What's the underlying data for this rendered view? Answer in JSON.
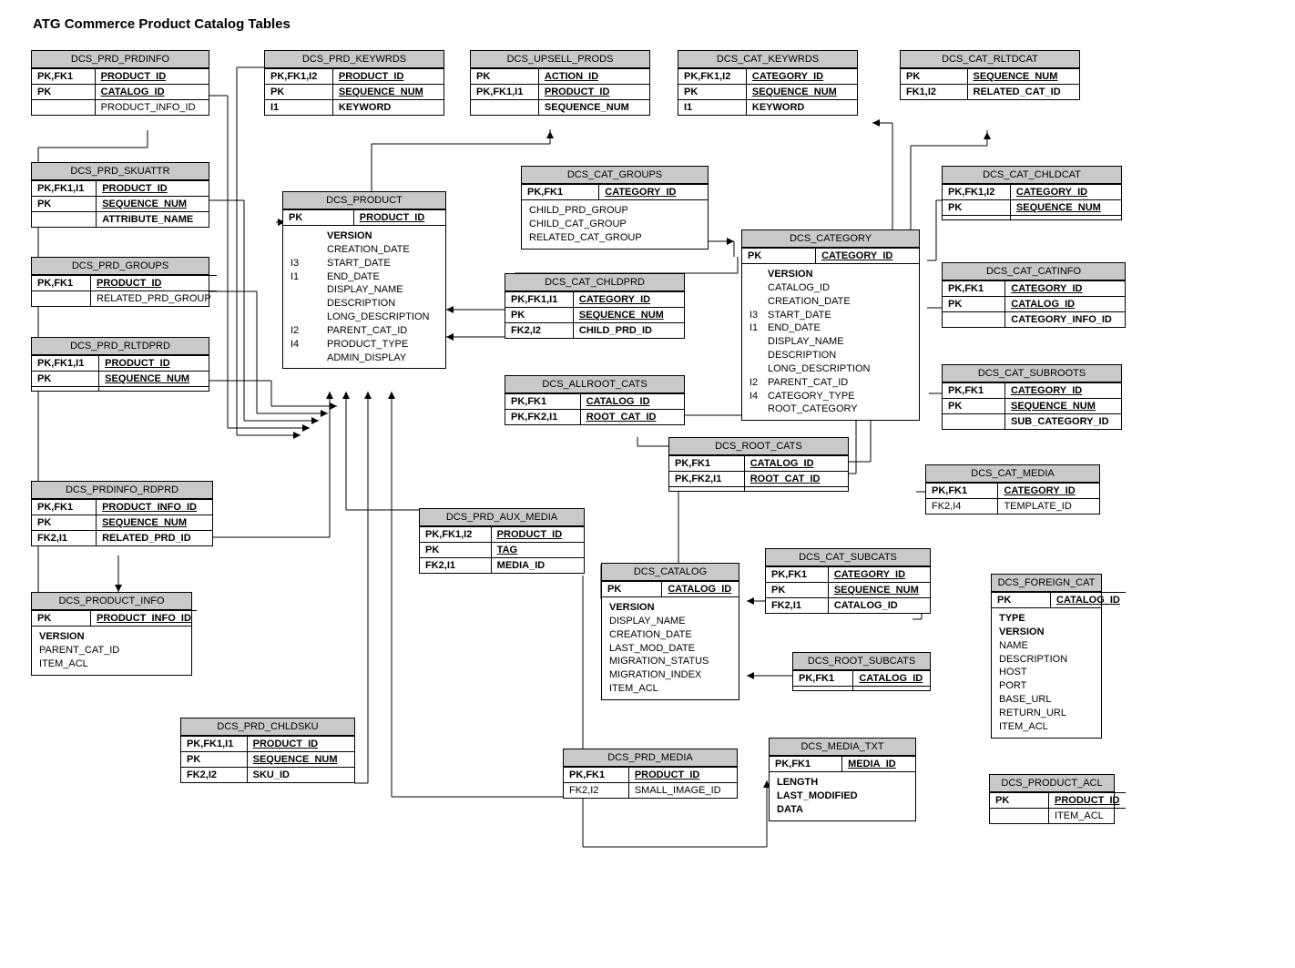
{
  "title": "ATG Commerce Product Catalog Tables",
  "tables": {
    "prd_prdinfo": {
      "name": "DCS_PRD_PRDINFO",
      "rows": [
        {
          "key": "PK,FK1",
          "val": "PRODUCT_ID",
          "pk": true
        },
        {
          "key": "PK",
          "val": "CATALOG_ID",
          "pk": true
        },
        {
          "key": "",
          "val": "PRODUCT_INFO_ID",
          "plain": true
        }
      ]
    },
    "prd_keywrds": {
      "name": "DCS_PRD_KEYWRDS",
      "rows": [
        {
          "key": "PK,FK1,I2",
          "val": "PRODUCT_ID",
          "pk": true
        },
        {
          "key": "PK",
          "val": "SEQUENCE_NUM",
          "pk": true
        },
        {
          "key": "I1",
          "val": "KEYWORD",
          "bold": true
        }
      ]
    },
    "upsell_prods": {
      "name": "DCS_UPSELL_PRODS",
      "rows": [
        {
          "key": "PK",
          "val": "ACTION_ID",
          "pk": true
        },
        {
          "key": "PK,FK1,I1",
          "val": "PRODUCT_ID",
          "pk": true
        },
        {
          "key": "",
          "val": "SEQUENCE_NUM",
          "bold": true
        }
      ]
    },
    "cat_keywrds": {
      "name": "DCS_CAT_KEYWRDS",
      "rows": [
        {
          "key": "PK,FK1,I2",
          "val": "CATEGORY_ID",
          "pk": true
        },
        {
          "key": "PK",
          "val": "SEQUENCE_NUM",
          "pk": true
        },
        {
          "key": "I1",
          "val": "KEYWORD",
          "bold": true
        }
      ]
    },
    "cat_rltdcat": {
      "name": "DCS_CAT_RLTDCAT",
      "rows": [
        {
          "key": "PK",
          "val": "SEQUENCE_NUM",
          "pk": true
        },
        {
          "key": "FK1,I2",
          "val": "RELATED_CAT_ID",
          "bold": true
        }
      ]
    },
    "prd_skuattr": {
      "name": "DCS_PRD_SKUATTR",
      "rows": [
        {
          "key": "PK,FK1,I1",
          "val": "PRODUCT_ID",
          "pk": true
        },
        {
          "key": "PK",
          "val": "SEQUENCE_NUM",
          "pk": true
        },
        {
          "key": "",
          "val": "ATTRIBUTE_NAME",
          "bold": true
        }
      ]
    },
    "prd_groups": {
      "name": "DCS_PRD_GROUPS",
      "rows": [
        {
          "key": "PK,FK1",
          "val": "PRODUCT_ID",
          "pk": true
        },
        {
          "key": "",
          "val": "RELATED_PRD_GROUP",
          "plain": true
        }
      ]
    },
    "prd_rltdprd": {
      "name": "DCS_PRD_RLTDPRD",
      "rows": [
        {
          "key": "PK,FK1,I1",
          "val": "PRODUCT_ID",
          "pk": true
        },
        {
          "key": "PK",
          "val": "SEQUENCE_NUM",
          "pk": true
        },
        {
          "key": "",
          "val": "",
          "plain": true
        }
      ]
    },
    "dcs_product": {
      "name": "DCS_PRODUCT",
      "rows": [
        {
          "key": "PK",
          "val": "PRODUCT_ID",
          "pk": true
        }
      ],
      "body": [
        {
          "t": "VERSION",
          "b": true
        },
        {
          "pre": "",
          "t": "CREATION_DATE"
        },
        {
          "pre": "I3",
          "t": "START_DATE"
        },
        {
          "pre": "I1",
          "t": "END_DATE"
        },
        {
          "t": "DISPLAY_NAME"
        },
        {
          "t": "DESCRIPTION"
        },
        {
          "t": "LONG_DESCRIPTION"
        },
        {
          "pre": "I2",
          "t": "PARENT_CAT_ID"
        },
        {
          "pre": "I4",
          "t": "PRODUCT_TYPE"
        },
        {
          "t": "ADMIN_DISPLAY"
        }
      ]
    },
    "cat_groups": {
      "name": "DCS_CAT_GROUPS",
      "rows": [
        {
          "key": "PK,FK1",
          "val": "CATEGORY_ID",
          "pk": true
        }
      ],
      "body": [
        {
          "t": "CHILD_PRD_GROUP"
        },
        {
          "t": "CHILD_CAT_GROUP"
        },
        {
          "t": "RELATED_CAT_GROUP"
        }
      ]
    },
    "cat_chldcat": {
      "name": "DCS_CAT_CHLDCAT",
      "rows": [
        {
          "key": "PK,FK1,I2",
          "val": "CATEGORY_ID",
          "pk": true
        },
        {
          "key": "PK",
          "val": "SEQUENCE_NUM",
          "pk": true
        },
        {
          "key": "",
          "val": "",
          "plain": true
        }
      ]
    },
    "dcs_category": {
      "name": "DCS_CATEGORY",
      "rows": [
        {
          "key": "PK",
          "val": "CATEGORY_ID",
          "pk": true
        }
      ],
      "body": [
        {
          "t": "VERSION",
          "b": true
        },
        {
          "t": "CATALOG_ID"
        },
        {
          "t": "CREATION_DATE"
        },
        {
          "pre": "I3",
          "t": "START_DATE"
        },
        {
          "pre": "I1",
          "t": "END_DATE"
        },
        {
          "t": "DISPLAY_NAME"
        },
        {
          "t": "DESCRIPTION"
        },
        {
          "t": "LONG_DESCRIPTION"
        },
        {
          "pre": "I2",
          "t": "PARENT_CAT_ID"
        },
        {
          "pre": "I4",
          "t": "CATEGORY_TYPE"
        },
        {
          "t": "ROOT_CATEGORY"
        }
      ]
    },
    "cat_chldprd": {
      "name": "DCS_CAT_CHLDPRD",
      "rows": [
        {
          "key": "PK,FK1,I1",
          "val": "CATEGORY_ID",
          "pk": true
        },
        {
          "key": "PK",
          "val": "SEQUENCE_NUM",
          "pk": true
        },
        {
          "key": "FK2,I2",
          "val": "CHILD_PRD_ID",
          "bold": true
        }
      ]
    },
    "cat_catinfo": {
      "name": "DCS_CAT_CATINFO",
      "rows": [
        {
          "key": "PK,FK1",
          "val": "CATEGORY_ID",
          "pk": true
        },
        {
          "key": "PK",
          "val": "CATALOG_ID",
          "pk": true
        },
        {
          "key": "",
          "val": "CATEGORY_INFO_ID",
          "bold": true
        }
      ]
    },
    "allroot_cats": {
      "name": "DCS_ALLROOT_CATS",
      "rows": [
        {
          "key": "PK,FK1",
          "val": "CATALOG_ID",
          "pk": true
        },
        {
          "key": "PK,FK2,I1",
          "val": "ROOT_CAT_ID",
          "pk": true
        }
      ]
    },
    "cat_subroots": {
      "name": "DCS_CAT_SUBROOTS",
      "rows": [
        {
          "key": "PK,FK1",
          "val": "CATEGORY_ID",
          "pk": true
        },
        {
          "key": "PK",
          "val": "SEQUENCE_NUM",
          "pk": true
        },
        {
          "key": "",
          "val": "SUB_CATEGORY_ID",
          "bold": true
        }
      ]
    },
    "root_cats": {
      "name": "DCS_ROOT_CATS",
      "rows": [
        {
          "key": "PK,FK1",
          "val": "CATALOG_ID",
          "pk": true
        },
        {
          "key": "PK,FK2,I1",
          "val": "ROOT_CAT_ID",
          "pk": true
        },
        {
          "key": "",
          "val": "",
          "plain": true
        }
      ]
    },
    "cat_media": {
      "name": "DCS_CAT_MEDIA",
      "rows": [
        {
          "key": "PK,FK1",
          "val": "CATEGORY_ID",
          "pk": true
        },
        {
          "key": "FK2,I4",
          "val": "TEMPLATE_ID",
          "plain": true,
          "knb": true
        }
      ]
    },
    "prdinfo_rdprd": {
      "name": "DCS_PRDINFO_RDPRD",
      "rows": [
        {
          "key": "PK,FK1",
          "val": "PRODUCT_INFO_ID",
          "pk": true
        },
        {
          "key": "PK",
          "val": "SEQUENCE_NUM",
          "pk": true
        },
        {
          "key": "FK2,I1",
          "val": "RELATED_PRD_ID",
          "bold": true
        }
      ]
    },
    "prd_aux_media": {
      "name": "DCS_PRD_AUX_MEDIA",
      "rows": [
        {
          "key": "PK,FK1,I2",
          "val": "PRODUCT_ID",
          "pk": true
        },
        {
          "key": "PK",
          "val": "TAG",
          "pk": true
        },
        {
          "key": "FK2,I1",
          "val": "MEDIA_ID",
          "bold": true
        }
      ]
    },
    "cat_subcats": {
      "name": "DCS_CAT_SUBCATS",
      "rows": [
        {
          "key": "PK,FK1",
          "val": "CATEGORY_ID",
          "pk": true
        },
        {
          "key": "PK",
          "val": "SEQUENCE_NUM",
          "pk": true
        },
        {
          "key": "FK2,I1",
          "val": "CATALOG_ID",
          "bold": true
        }
      ]
    },
    "dcs_catalog": {
      "name": "DCS_CATALOG",
      "rows": [
        {
          "key": "PK",
          "val": "CATALOG_ID",
          "pk": true
        }
      ],
      "body": [
        {
          "t": "VERSION",
          "b": true
        },
        {
          "t": "DISPLAY_NAME"
        },
        {
          "t": "CREATION_DATE"
        },
        {
          "t": "LAST_MOD_DATE"
        },
        {
          "t": "MIGRATION_STATUS"
        },
        {
          "t": "MIGRATION_INDEX"
        },
        {
          "t": "ITEM_ACL"
        }
      ]
    },
    "foreign_cat": {
      "name": "DCS_FOREIGN_CAT",
      "rows": [
        {
          "key": "PK",
          "val": "CATALOG_ID",
          "pk": true
        }
      ],
      "body": [
        {
          "t": "TYPE",
          "b": true
        },
        {
          "t": "VERSION",
          "b": true
        },
        {
          "t": "NAME"
        },
        {
          "t": "DESCRIPTION"
        },
        {
          "t": "HOST"
        },
        {
          "t": "PORT"
        },
        {
          "t": "BASE_URL"
        },
        {
          "t": "RETURN_URL"
        },
        {
          "t": "ITEM_ACL"
        }
      ]
    },
    "product_info": {
      "name": "DCS_PRODUCT_INFO",
      "rows": [
        {
          "key": "PK",
          "val": "PRODUCT_INFO_ID",
          "pk": true
        }
      ],
      "body": [
        {
          "t": "VERSION",
          "b": true
        },
        {
          "t": "PARENT_CAT_ID"
        },
        {
          "t": "ITEM_ACL"
        }
      ]
    },
    "root_subcats": {
      "name": "DCS_ROOT_SUBCATS",
      "rows": [
        {
          "key": "PK,FK1",
          "val": "CATALOG_ID",
          "pk": true
        },
        {
          "key": "",
          "val": "",
          "plain": true
        }
      ]
    },
    "prd_chldsku": {
      "name": "DCS_PRD_CHLDSKU",
      "rows": [
        {
          "key": "PK,FK1,I1",
          "val": "PRODUCT_ID",
          "pk": true
        },
        {
          "key": "PK",
          "val": "SEQUENCE_NUM",
          "pk": true
        },
        {
          "key": "FK2,I2",
          "val": "SKU_ID",
          "bold": true
        }
      ]
    },
    "prd_media": {
      "name": "DCS_PRD_MEDIA",
      "rows": [
        {
          "key": "PK,FK1",
          "val": "PRODUCT_ID",
          "pk": true
        },
        {
          "key": "FK2,I2",
          "val": "SMALL_IMAGE_ID",
          "plain": true,
          "knb": true
        }
      ]
    },
    "media_txt": {
      "name": "DCS_MEDIA_TXT",
      "rows": [
        {
          "key": "PK,FK1",
          "val": "MEDIA_ID",
          "pk": true
        }
      ],
      "body": [
        {
          "t": "LENGTH",
          "b": true
        },
        {
          "t": "LAST_MODIFIED",
          "b": true
        },
        {
          "t": "DATA",
          "b": true
        }
      ]
    },
    "product_acl": {
      "name": "DCS_PRODUCT_ACL",
      "rows": [
        {
          "key": "PK",
          "val": "PRODUCT_ID",
          "pk": true
        },
        {
          "key": "",
          "val": "ITEM_ACL",
          "plain": true
        }
      ]
    }
  }
}
